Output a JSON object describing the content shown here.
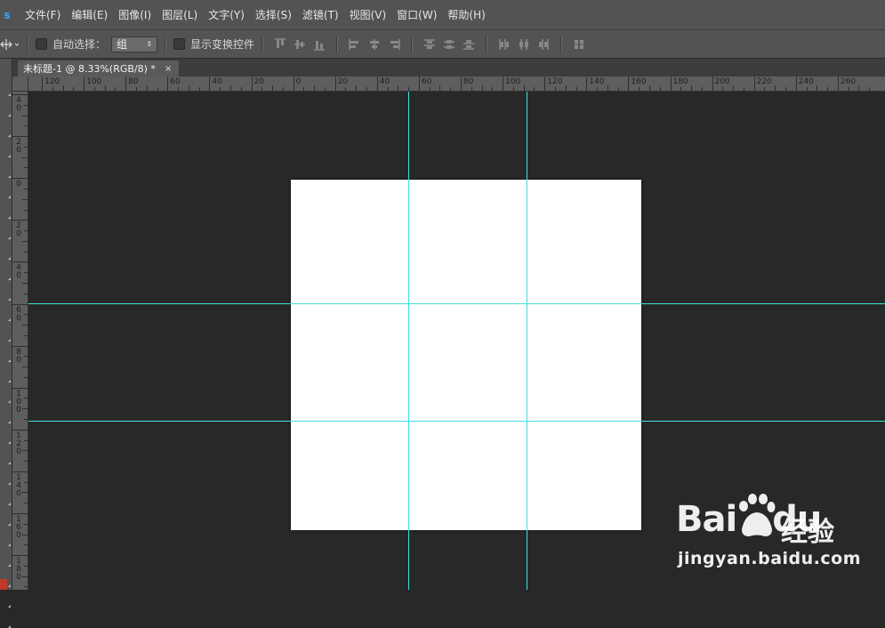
{
  "menubar": {
    "logo": "s",
    "items": [
      "文件(F)",
      "编辑(E)",
      "图像(I)",
      "图层(L)",
      "文字(Y)",
      "选择(S)",
      "滤镜(T)",
      "视图(V)",
      "窗口(W)",
      "帮助(H)"
    ]
  },
  "options": {
    "move_tool_icon": "move-tool-icon",
    "auto_select_label": "自动选择：",
    "auto_select_value": "组",
    "show_transform_label": "显示变换控件"
  },
  "document_tab": {
    "title": "未标题-1 @ 8.33%(RGB/8) *",
    "close": "×"
  },
  "rulers": {
    "h_labels": [
      "120",
      "100",
      "80",
      "60",
      "40",
      "20",
      "0",
      "20",
      "40",
      "60",
      "80",
      "100",
      "120",
      "140",
      "160",
      "180",
      "200",
      "220",
      "240",
      "260"
    ],
    "v_labels": [
      "40",
      "20",
      "0",
      "20",
      "40",
      "60",
      "80",
      "100",
      "120",
      "140",
      "160",
      "180"
    ]
  },
  "watermark": {
    "brand_prefix": "Bai",
    "brand_suffix": "du",
    "product": "经验",
    "url": "jingyan.baidu.com"
  },
  "colors": {
    "guide": "#3fe0e0",
    "ui_panel": "#535353",
    "workspace": "#282828",
    "foreground_swatch": "#c0392b"
  }
}
